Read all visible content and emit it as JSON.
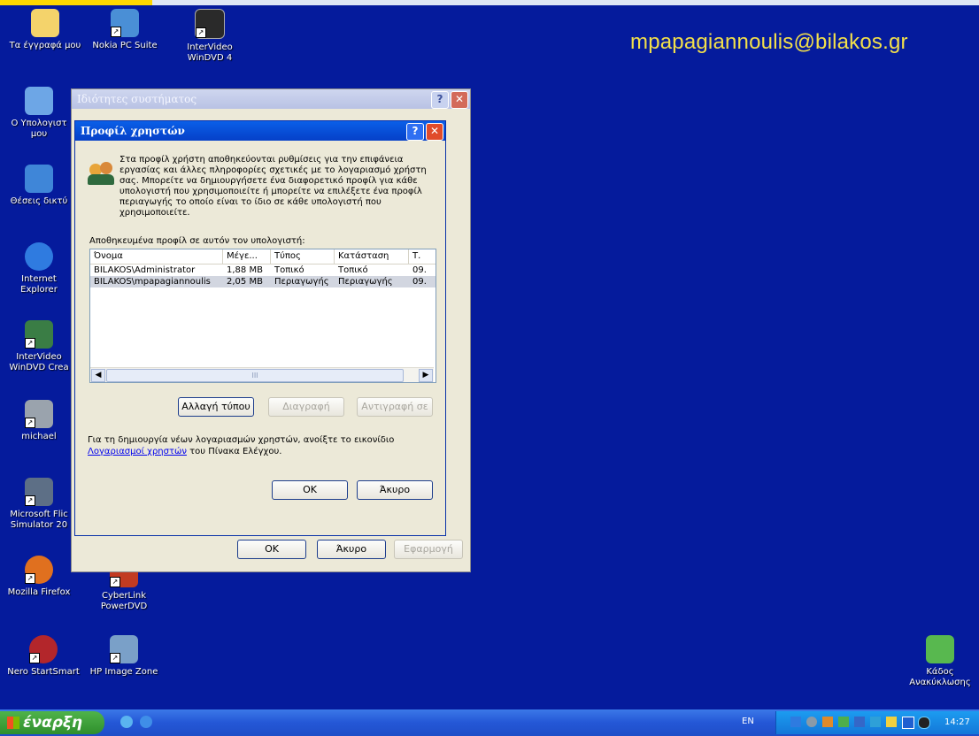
{
  "desktop": {
    "email_text": "mpapagiannoulis@bilakos.gr",
    "icons": [
      {
        "label": "Τα έγγραφά μου",
        "icon": "my-documents-icon"
      },
      {
        "label": "Nokia PC Suite",
        "icon": "nokia-pc-suite-icon"
      },
      {
        "label": "InterVideo WinDVD 4",
        "icon": "windvd-icon"
      },
      {
        "label": "Ο Υπολογιστ μου",
        "icon": "my-computer-icon"
      },
      {
        "label": "Θέσεις δικτύ",
        "icon": "network-places-icon"
      },
      {
        "label": "Internet Explorer",
        "icon": "internet-explorer-icon"
      },
      {
        "label": "InterVideo WinDVD Crea",
        "icon": "windvd-creator-icon"
      },
      {
        "label": "michael",
        "icon": "user-folder-icon"
      },
      {
        "label": "Microsoft Flic Simulator 20",
        "icon": "flight-simulator-icon"
      },
      {
        "label": "Mozilla Firefox",
        "icon": "firefox-icon"
      },
      {
        "label": "CyberLink PowerDVD",
        "icon": "powerdvd-icon"
      },
      {
        "label": "Nero StartSmart",
        "icon": "nero-icon"
      },
      {
        "label": "HP Image Zone",
        "icon": "hp-image-zone-icon"
      },
      {
        "label": "Κάδος Ανακύκλωσης",
        "icon": "recycle-bin-icon"
      }
    ]
  },
  "system_properties": {
    "title": "Ιδιότητες συστήματος",
    "ok": "OK",
    "cancel": "Άκυρο",
    "apply": "Εφαρμογή"
  },
  "user_profiles": {
    "title": "Προφίλ χρηστών",
    "help": "?",
    "close": "X",
    "description": "Στα προφίλ χρήστη αποθηκεύονται ρυθμίσεις για την επιφάνεια εργασίας και άλλες πληροφορίες σχετικές με το λογαριασμό χρήστη σας. Μπορείτε να δημιουργήσετε ένα διαφορετικό προφίλ για κάθε υπολογιστή που χρησιμοποιείτε ή μπορείτε να επιλέξετε ένα προφίλ περιαγωγής το οποίο είναι το ίδιο σε κάθε υπολογιστή που χρησιμοποιείτε.",
    "list_label": "Αποθηκευμένα προφίλ σε αυτόν τον υπολογιστή:",
    "columns": [
      "Όνομα",
      "Μέγε...",
      "Τύπος",
      "Κατάσταση",
      "Τ."
    ],
    "rows": [
      {
        "name": "BILAKOS\\Administrator",
        "size": "1,88 MB",
        "type": "Τοπικό",
        "status": "Τοπικό",
        "t": "09."
      },
      {
        "name": "BILAKOS\\mpapagiannoulis",
        "size": "2,05 MB",
        "type": "Περιαγωγής",
        "status": "Περιαγωγής",
        "t": "09."
      }
    ],
    "scroll_grip": "III",
    "change_type": "Αλλαγή τύπου",
    "delete": "Διαγραφή",
    "copy_to": "Αντιγραφή σε",
    "footer_text": "Για τη δημιουργία νέων λογαριασμών χρηστών, ανοίξτε το εικονίδιο",
    "footer_link": "Λογαριασμοί χρηστών",
    "footer_tail": "του Πίνακα Ελέγχου.",
    "ok": "OK",
    "cancel": "Άκυρο"
  },
  "taskbar": {
    "start_label": "έναρξη",
    "lang": "EN",
    "time": "14:27"
  },
  "colors": {
    "desktop": "#051b9c",
    "email": "#f3e04a",
    "title_active": "#0a5fe8",
    "link": "#0000ee"
  }
}
